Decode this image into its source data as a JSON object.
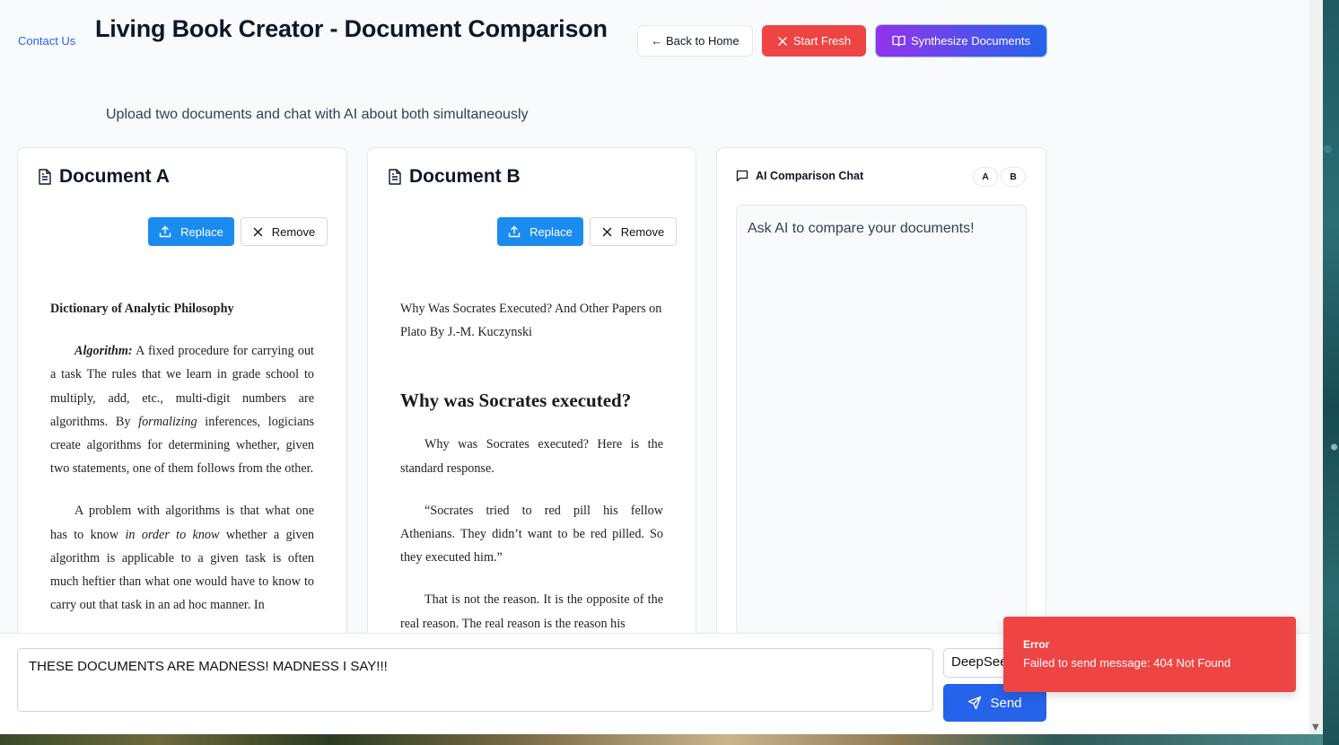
{
  "header": {
    "contact_label": "Contact Us",
    "title": "Living Book Creator - Document Comparison",
    "back_label": "← Back to Home",
    "start_fresh_label": "Start Fresh",
    "synthesize_label": "Synthesize Documents",
    "subtitle": "Upload two documents and chat with AI about both simultaneously"
  },
  "document_a": {
    "title": "Document A",
    "replace_label": "Replace",
    "remove_label": "Remove",
    "heading": "Dictionary of Analytic Philosophy",
    "term": "Algorithm:",
    "p1_rest_start": " A fixed procedure for carrying out a task The rules that we learn in grade school to multiply, add, etc., multi-digit numbers are algorithms. By ",
    "p1_italic": "formalizing",
    "p1_rest_end": " inferences, logicians create algorithms for determining whether, given two statements, one of them follows from the other.",
    "p2_start": "A problem with algorithms is that what one has to know ",
    "p2_italic": "in order to know",
    "p2_end": " whether a given algorithm is applicable to a given task is often much heftier than what one would have to know to carry out that task in an ad hoc manner. In"
  },
  "document_b": {
    "title": "Document B",
    "replace_label": "Replace",
    "remove_label": "Remove",
    "intro": "Why Was Socrates Executed? And Other Papers on Plato By J.-M. Kuczynski",
    "heading": "Why was Socrates executed?",
    "p1": "Why was Socrates executed? Here is the standard response.",
    "p2": "“Socrates tried to red pill his fellow Athenians. They didn’t want to be red pilled. So they executed him.”",
    "p3": "That is not the reason. It is the opposite of the real reason. The real reason is the reason his"
  },
  "chat": {
    "title": "AI Comparison Chat",
    "badge_a": "A",
    "badge_b": "B",
    "empty_text": "Ask AI to compare your documents!"
  },
  "composer": {
    "message": "THESE DOCUMENTS ARE MADNESS! MADNESS I SAY!!!",
    "model": "DeepSeek",
    "send_label": "Send"
  },
  "toast": {
    "title": "Error",
    "message": "Failed to send message: 404 Not Found"
  },
  "colors": {
    "primary": "#2563eb",
    "danger": "#ef4444",
    "purple": "#9333ea",
    "upload_blue": "#1a8cf0"
  }
}
